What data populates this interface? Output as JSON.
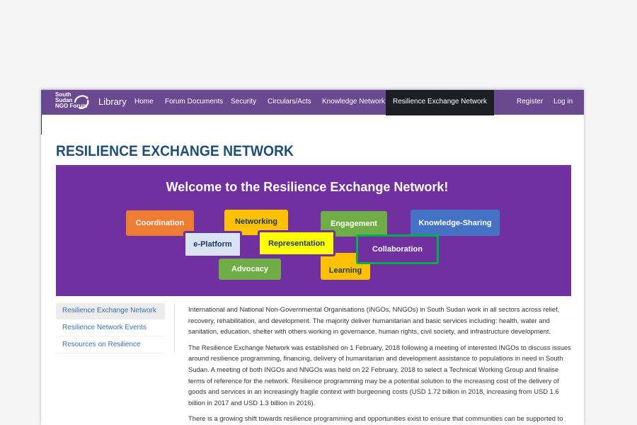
{
  "navbar": {
    "logo_text": "South\nSudan\nNGO Forum",
    "brand": "Library",
    "items": [
      {
        "label": "Home"
      },
      {
        "label": "Forum Documents"
      },
      {
        "label": "Security"
      },
      {
        "label": "Circulars/Acts"
      },
      {
        "label": "Knowledge Network"
      },
      {
        "label": "Resilience Exchange Network",
        "active": true
      },
      {
        "label": "Register"
      },
      {
        "label": "Log in"
      }
    ],
    "background_color": "#6b4990",
    "active_color": "#1e1f24"
  },
  "page": {
    "title": "RESILIENCE EXCHANGE NETWORK"
  },
  "banner": {
    "title": "Welcome to the Resilience Exchange Network!",
    "background_color": "#7030a0",
    "tiles": [
      {
        "label": "Coordination",
        "color": "#ed7d31"
      },
      {
        "label": "Networking",
        "color": "#ffc000"
      },
      {
        "label": "Engagement",
        "color": "#70ad47"
      },
      {
        "label": "Knowledge-Sharing",
        "color": "#4472c4"
      },
      {
        "label": "e-Platform",
        "color": "#dae3f3"
      },
      {
        "label": "Representation",
        "color": "#ffff00"
      },
      {
        "label": "Collaboration",
        "color": "#7030a0"
      },
      {
        "label": "Advocacy",
        "color": "#70ad47"
      },
      {
        "label": "Learning",
        "color": "#ffc000"
      }
    ]
  },
  "sidebar": {
    "items": [
      {
        "label": "Resilience Exchange Network",
        "active": true
      },
      {
        "label": "Resilience Network Events"
      },
      {
        "label": "Resources on Resilience"
      }
    ]
  },
  "content": {
    "paragraphs": [
      "International and National Non-Governmental Organisations (INGOs, NNGOs) in South Sudan work in all sectors across relief, recovery, rehabilitation, and development. The majority deliver humanitarian and basic services including: health, water and sanitation, education, shelter with others working in governance, human rights, civil society, and infrastructure development.",
      "The Resilience Exchange Network was established on 1 February, 2018 following a meeting of interested INGOs to discuss issues around resilience programming, financing, delivery of humanitarian and development assistance to populations in need in South Sudan. A meeting of both INGOs and NNGOs was held on 22 February, 2018 to select a Technical Working Group and finalise terms of reference for the network. Resilience programming may be a potential solution to the increasing cost of the delivery of goods and services in an increasingly fragile context with burgeoning costs (USD 1.72 billion in 2018, increasing from USD 1.6 billion in 2017 and USD 1.3 billion in 2016).",
      "There is a growing shift towards resilience programming and opportunities exist to ensure that communities can be supported to be"
    ]
  }
}
